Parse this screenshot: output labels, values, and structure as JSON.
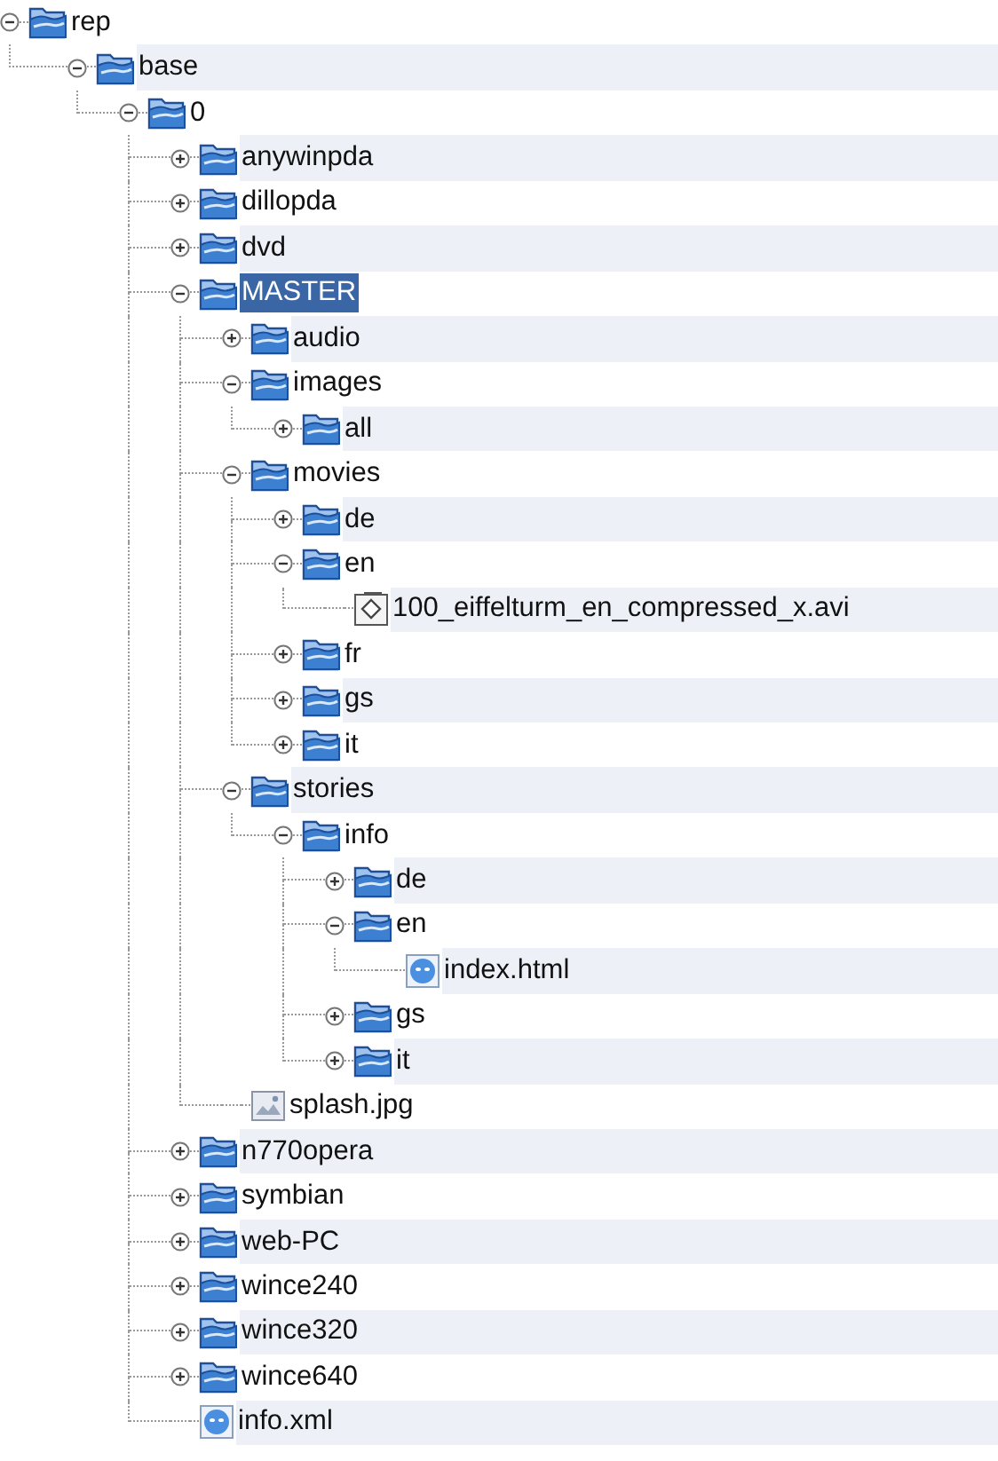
{
  "tree": {
    "label": "rep",
    "kind": "folder",
    "expanded": true,
    "selected": false,
    "children": [
      {
        "label": "base",
        "kind": "folder",
        "expanded": true,
        "selected": false,
        "children": [
          {
            "label": "0",
            "kind": "folder",
            "expanded": true,
            "selected": false,
            "children": [
              {
                "label": "anywinpda",
                "kind": "folder",
                "expanded": false,
                "selected": false
              },
              {
                "label": "dillopda",
                "kind": "folder",
                "expanded": false,
                "selected": false
              },
              {
                "label": "dvd",
                "kind": "folder",
                "expanded": false,
                "selected": false
              },
              {
                "label": "MASTER",
                "kind": "folder",
                "expanded": true,
                "selected": true,
                "children": [
                  {
                    "label": "audio",
                    "kind": "folder",
                    "expanded": false,
                    "selected": false
                  },
                  {
                    "label": "images",
                    "kind": "folder",
                    "expanded": true,
                    "selected": false,
                    "children": [
                      {
                        "label": "all",
                        "kind": "folder",
                        "expanded": false,
                        "selected": false
                      }
                    ]
                  },
                  {
                    "label": "movies",
                    "kind": "folder",
                    "expanded": true,
                    "selected": false,
                    "children": [
                      {
                        "label": "de",
                        "kind": "folder",
                        "expanded": false,
                        "selected": false
                      },
                      {
                        "label": "en",
                        "kind": "folder",
                        "expanded": true,
                        "selected": false,
                        "children": [
                          {
                            "label": "100_eiffelturm_en_compressed_x.avi",
                            "kind": "video",
                            "selected": false
                          }
                        ]
                      },
                      {
                        "label": "fr",
                        "kind": "folder",
                        "expanded": false,
                        "selected": false
                      },
                      {
                        "label": "gs",
                        "kind": "folder",
                        "expanded": false,
                        "selected": false
                      },
                      {
                        "label": "it",
                        "kind": "folder",
                        "expanded": false,
                        "selected": false
                      }
                    ]
                  },
                  {
                    "label": "stories",
                    "kind": "folder",
                    "expanded": true,
                    "selected": false,
                    "children": [
                      {
                        "label": "info",
                        "kind": "folder",
                        "expanded": true,
                        "selected": false,
                        "children": [
                          {
                            "label": "de",
                            "kind": "folder",
                            "expanded": false,
                            "selected": false
                          },
                          {
                            "label": "en",
                            "kind": "folder",
                            "expanded": true,
                            "selected": false,
                            "children": [
                              {
                                "label": "index.html",
                                "kind": "web",
                                "selected": false
                              }
                            ]
                          },
                          {
                            "label": "gs",
                            "kind": "folder",
                            "expanded": false,
                            "selected": false
                          },
                          {
                            "label": "it",
                            "kind": "folder",
                            "expanded": false,
                            "selected": false
                          }
                        ]
                      }
                    ]
                  },
                  {
                    "label": "splash.jpg",
                    "kind": "image",
                    "selected": false
                  }
                ]
              },
              {
                "label": "n770opera",
                "kind": "folder",
                "expanded": false,
                "selected": false
              },
              {
                "label": "symbian",
                "kind": "folder",
                "expanded": false,
                "selected": false
              },
              {
                "label": "web-PC",
                "kind": "folder",
                "expanded": false,
                "selected": false
              },
              {
                "label": "wince240",
                "kind": "folder",
                "expanded": false,
                "selected": false
              },
              {
                "label": "wince320",
                "kind": "folder",
                "expanded": false,
                "selected": false
              },
              {
                "label": "wince640",
                "kind": "folder",
                "expanded": false,
                "selected": false
              },
              {
                "label": "info.xml",
                "kind": "web",
                "selected": false
              }
            ]
          }
        ]
      }
    ]
  }
}
